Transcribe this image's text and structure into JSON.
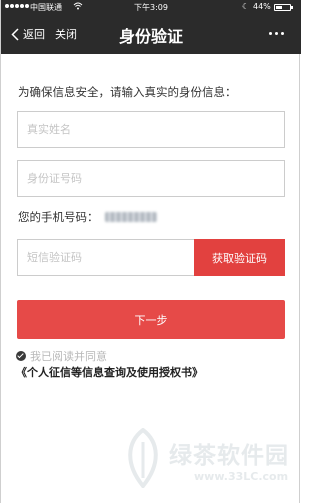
{
  "status_bar": {
    "carrier": "中国联通",
    "time": "下午3:09",
    "battery_percent": "44%",
    "battery_level": 0.44
  },
  "nav": {
    "back_label": "返回",
    "close_label": "关闭",
    "title": "身份验证"
  },
  "form": {
    "intro": "为确保信息安全，请输入真实的身份信息：",
    "name_placeholder": "真实姓名",
    "id_placeholder": "身份证号码",
    "phone_label": "您的手机号码：",
    "sms_placeholder": "短信验证码",
    "get_code_label": "获取验证码",
    "next_label": "下一步",
    "agree_prefix": "我已阅读并同意",
    "agree_link": "《个人征信等信息查询及使用授权书》"
  },
  "watermark": {
    "name": "绿茶软件园",
    "url": "www.33LC.com"
  },
  "colors": {
    "nav_background": "#2b2b2b",
    "accent_red": "#e64a48",
    "get_code_red": "#e2413f"
  }
}
